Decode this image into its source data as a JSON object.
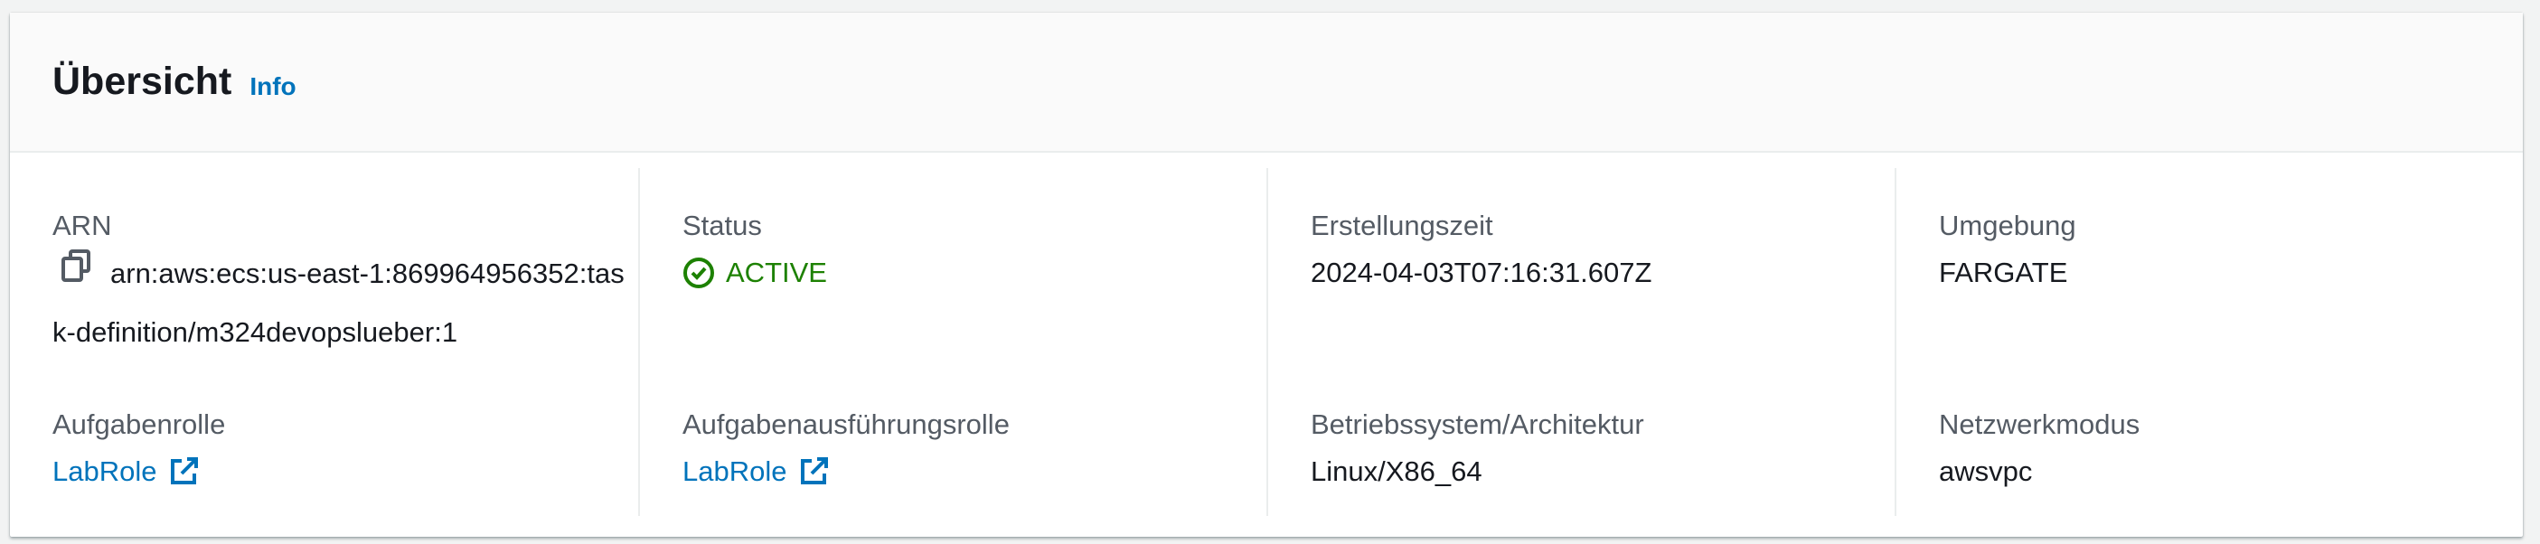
{
  "header": {
    "title": "Übersicht",
    "info_link": "Info"
  },
  "fields": {
    "arn": {
      "label": "ARN",
      "value": "arn:aws:ecs:us-east-1:869964956352:task-definition/m324devopslueber:1",
      "icon": "copy-icon"
    },
    "status": {
      "label": "Status",
      "value": "ACTIVE",
      "icon": "check-circle-icon",
      "color": "#1d8102"
    },
    "created": {
      "label": "Erstellungszeit",
      "value": "2024-04-03T07:16:31.607Z"
    },
    "environment": {
      "label": "Umgebung",
      "value": "FARGATE"
    },
    "task_role": {
      "label": "Aufgabenrolle",
      "value": "LabRole",
      "icon": "external-link-icon"
    },
    "execution_role": {
      "label": "Aufgabenausführungsrolle",
      "value": "LabRole",
      "icon": "external-link-icon"
    },
    "os_arch": {
      "label": "Betriebssystem/Architektur",
      "value": "Linux/X86_64"
    },
    "network_mode": {
      "label": "Netzwerkmodus",
      "value": "awsvpc"
    }
  },
  "colors": {
    "link": "#0073bb",
    "success": "#1d8102"
  }
}
